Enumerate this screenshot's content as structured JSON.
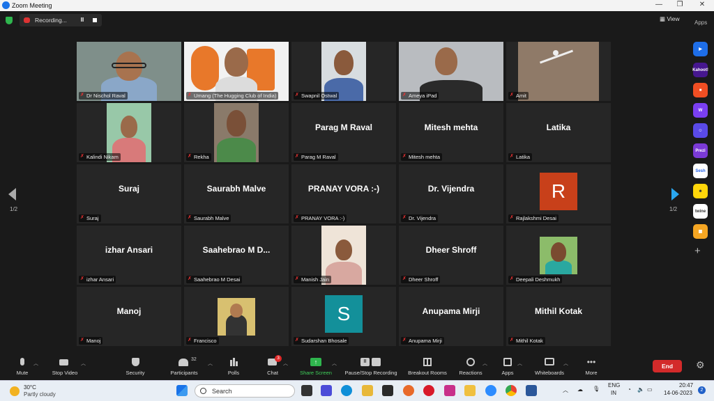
{
  "window": {
    "title": "Zoom Meeting",
    "min": "—",
    "restore": "❐",
    "close": "✕"
  },
  "top": {
    "recording": "Recording...",
    "view": "View",
    "apps": "Apps"
  },
  "participants": [
    {
      "name": "Dr Nischol Raval",
      "video": true
    },
    {
      "name": "Umang (The Hugging Club of India)",
      "video": true
    },
    {
      "name": "Swapnil Ostwal",
      "video": true
    },
    {
      "name": "Ameya iPad",
      "video": true
    },
    {
      "name": "Amit",
      "video": true
    },
    {
      "name": "Kalindi Nikam",
      "video": true
    },
    {
      "name": "Rekha",
      "video": true
    },
    {
      "name": "Parag M Raval",
      "big": "Parag M Raval"
    },
    {
      "name": "Mitesh mehta",
      "big": "Mitesh mehta"
    },
    {
      "name": "Latika",
      "big": "Latika"
    },
    {
      "name": "Suraj",
      "big": "Suraj"
    },
    {
      "name": "Saurabh Malve",
      "big": "Saurabh Malve"
    },
    {
      "name": "PRANAY VORA :-)",
      "big": "PRANAY VORA :-)"
    },
    {
      "name": "Dr. Vijendra",
      "big": "Dr. Vijendra"
    },
    {
      "name": "Rajlakshmi Desai",
      "avatar": "R",
      "avatar_color": "#c8401a"
    },
    {
      "name": "izhar Ansari",
      "big": "izhar Ansari"
    },
    {
      "name": "Saahebrao M Desai",
      "big": "Saahebrao  M  D..."
    },
    {
      "name": "Manish Jain",
      "video": true
    },
    {
      "name": "Dheer Shroff",
      "big": "Dheer Shroff"
    },
    {
      "name": "Deepali Deshmukh",
      "video": true
    },
    {
      "name": "Manoj",
      "big": "Manoj"
    },
    {
      "name": "Francisco",
      "video": true
    },
    {
      "name": "Sudarshan Bhosale",
      "avatar": "S",
      "avatar_color": "#13909a"
    },
    {
      "name": "Anupama Mirji",
      "big": "Anupama Mirji"
    },
    {
      "name": "Mithil Kotak",
      "big": "Mithil Kotak"
    }
  ],
  "pager": {
    "left": "1/2",
    "right": "1/2"
  },
  "toolbar": {
    "mute": "Mute",
    "stop_video": "Stop Video",
    "security": "Security",
    "participants": "Participants",
    "participants_count": "32",
    "polls": "Polls",
    "chat": "Chat",
    "chat_badge": "3",
    "share": "Share Screen",
    "record": "Pause/Stop Recording",
    "breakout": "Breakout Rooms",
    "reactions": "Reactions",
    "apps": "Apps",
    "whiteboards": "Whiteboards",
    "more": "More",
    "end": "End"
  },
  "apps_side": [
    "Kahoot!",
    "Prezi",
    "Sesh",
    "twine"
  ],
  "taskbar": {
    "temp": "30°C",
    "weather": "Partly cloudy",
    "search": "Search",
    "lang1": "ENG",
    "lang2": "IN",
    "time": "20:47",
    "date": "14-06-2023",
    "notif": "2"
  }
}
